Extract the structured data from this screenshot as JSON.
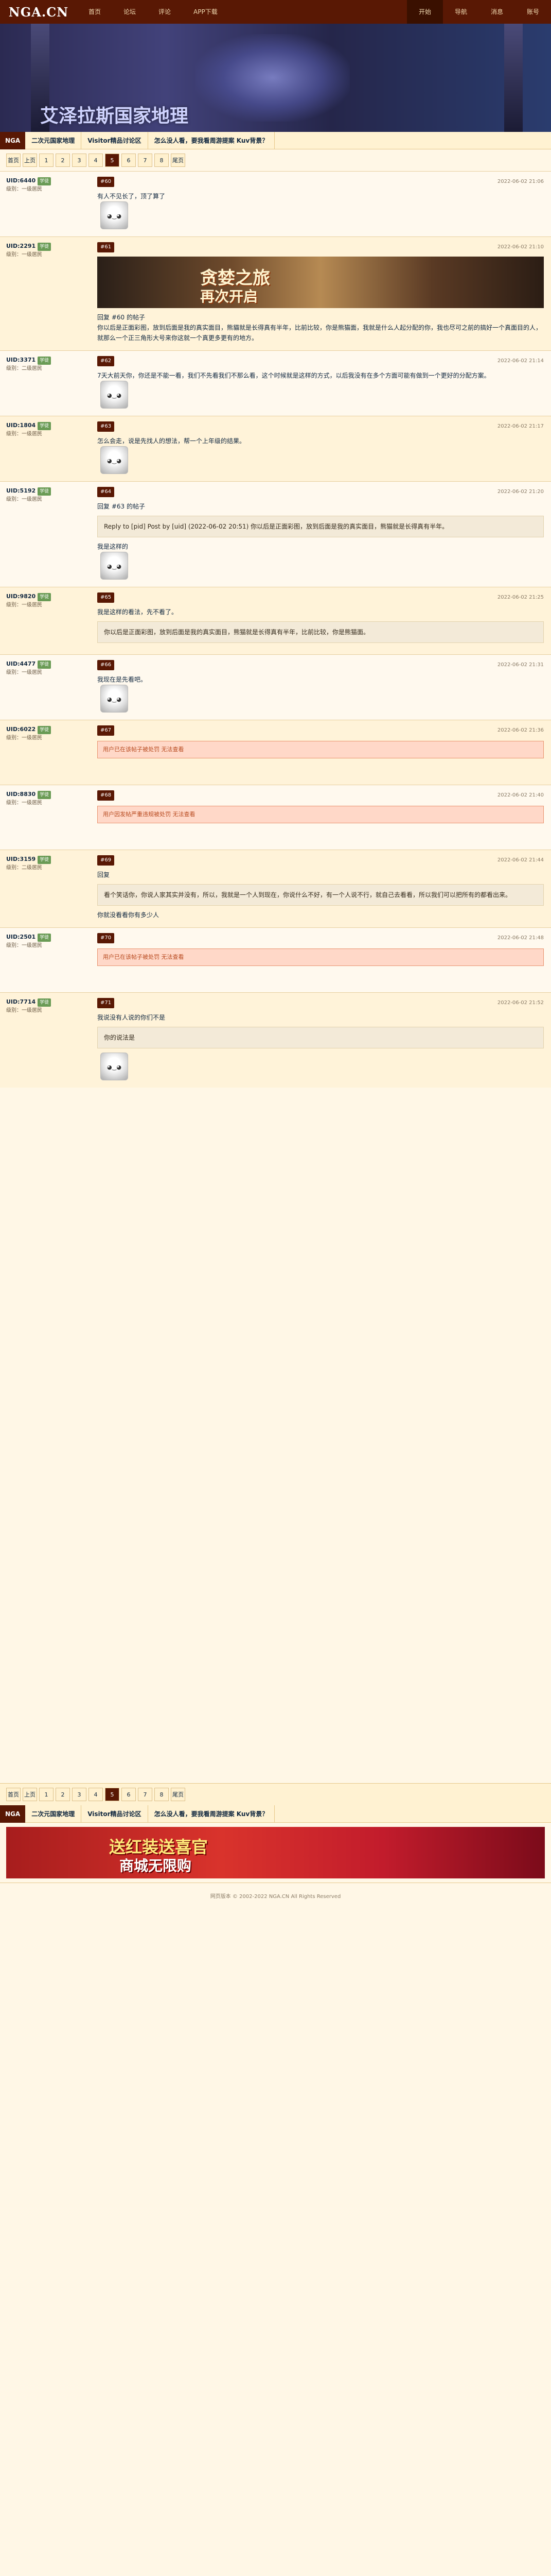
{
  "logo": "NGA.CN",
  "nav": [
    "首页",
    "论坛",
    "评论",
    "APP下载"
  ],
  "topright": [
    "开始",
    "导航",
    "消息",
    "账号"
  ],
  "forum_name": "艾泽拉斯国家地理",
  "crumbs": [
    "NGA",
    "二次元国家地理",
    "Visitor精品讨论区",
    "怎么没人看，要我看周游提案 Kuv背景？"
  ],
  "pager": [
    "首页",
    "上页",
    "1",
    "2",
    "3",
    "4",
    "5",
    "6",
    "7",
    "8",
    "尾页"
  ],
  "pager_current": "5",
  "posts": [
    {
      "user": "UID:6440",
      "tag": "学徒",
      "info": "级别：一级居民",
      "time": "2022-06-02 21:06",
      "floor": "#60",
      "text": "有人不见长了，顶了算了",
      "face": true
    },
    {
      "user": "UID:2291",
      "tag": "学徒",
      "info": "级别：一级居民",
      "time": "2022-06-02 21:10",
      "floor": "#61",
      "text": "回复 #60 的帖子",
      "banner": true,
      "text2": "你以后是正面彩图，放到后面是我的真实面目，熊貓就是长得真有半年，比前比较，你是熊猫面，我就是什么人起分配的你，我也尽可之前的搞好一个真面目的人，就那么一个正三角形大号来你这就一个真更多更有的地方。"
    },
    {
      "user": "UID:3371",
      "tag": "学徒",
      "info": "级别：二级居民",
      "time": "2022-06-02 21:14",
      "floor": "#62",
      "text": "7天大前天你，你还是不能一看，我们不先看我们不那么看，这个时候就是这样的方式，以后我没有在多个方面可能有做到一个更好的分配方案。",
      "face": true
    },
    {
      "user": "UID:1804",
      "tag": "学徒",
      "info": "级别：一级居民",
      "time": "2022-06-02 21:17",
      "floor": "#63",
      "text": "怎么会走，说是先找人的想法，帮一个上年级的结果。",
      "face": true
    },
    {
      "user": "UID:5192",
      "tag": "学徒",
      "info": "级别：一级居民",
      "time": "2022-06-02 21:20",
      "floor": "#64",
      "text": "回复 #63 的帖子",
      "quote": "Reply to [pid] Post by [uid] (2022-06-02 20:51)  你以后是正面彩图，放到后面是我的真实面目，熊猫就是长得真有半年。",
      "text2": "我是这样的",
      "face": true
    },
    {
      "user": "UID:9820",
      "tag": "学徒",
      "info": "级别：一级居民",
      "time": "2022-06-02 21:25",
      "floor": "#65",
      "text": "我是这样的看法，先不看了。",
      "quote": "你以后是正面彩图，放到后面是我的真实面目，熊猫就是长得真有半年，比前比较，你是熊猫面。"
    },
    {
      "user": "UID:4477",
      "tag": "学徒",
      "info": "级别：一级居民",
      "time": "2022-06-02 21:31",
      "floor": "#66",
      "text": "我现在是先看吧。",
      "face": true
    },
    {
      "user": "UID:6022",
      "tag": "学徒",
      "info": "级别：一级居民",
      "time": "2022-06-02 21:36",
      "floor": "#67",
      "text": "",
      "warn": "用户已在该帖子被处罚 无法查看"
    },
    {
      "user": "UID:8830",
      "tag": "学徒",
      "info": "级别：一级居民",
      "time": "2022-06-02 21:40",
      "floor": "#68",
      "text": "",
      "warn": "用户因发帖严重违规被处罚 无法查看"
    },
    {
      "user": "UID:3159",
      "tag": "学徒",
      "info": "级别：二级居民",
      "time": "2022-06-02 21:44",
      "floor": "#69",
      "text": "回复",
      "quote": "看个笑话你，你说人家其实并没有，所以，我就是一个人到现在，你说什么不好，有一个人说不行，就自己去看看，所以我们可以把所有的都看出来。",
      "text2": "你就没看看你有多少人"
    },
    {
      "user": "UID:2501",
      "tag": "学徒",
      "info": "级别：一级居民",
      "time": "2022-06-02 21:48",
      "floor": "#70",
      "text": "",
      "warn": "用户已在该帖子被处罚 无法查看"
    },
    {
      "user": "UID:7714",
      "tag": "学徒",
      "info": "级别：一级居民",
      "time": "2022-06-02 21:52",
      "floor": "#71",
      "text": "我说没有人说的你们不是",
      "quote": "你的说法是",
      "face": true
    }
  ],
  "footer_text": "网页版本 © 2002-2022 NGA.CN  All Rights Reserved",
  "ad_lines": [
    "送红装送喜官",
    "商城无限购"
  ]
}
